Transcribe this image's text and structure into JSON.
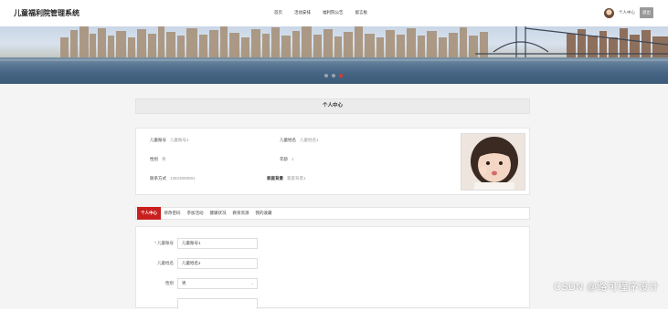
{
  "header": {
    "brand": "儿童福利院管理系统",
    "nav": [
      "首页",
      "活动安排",
      "福利院公告",
      "留言板"
    ],
    "user_center": "个人中心",
    "logout": "退出"
  },
  "carousel": {
    "slides": 3,
    "active_index": 2
  },
  "page_title": "个人中心",
  "profile": {
    "child_id_label": "儿童账号",
    "child_id_value": "儿童账号1",
    "child_name_label": "儿童姓名",
    "child_name_value": "儿童姓名1",
    "gender_label": "性别",
    "gender_value": "男",
    "age_label": "年龄",
    "age_value": "1",
    "phone_label": "联系方式",
    "phone_value": "13823888881",
    "family_label": "家庭背景",
    "family_value": "家庭背景1"
  },
  "tabs": [
    "个人中心",
    "修改密码",
    "参加活动",
    "健康状况",
    "教育资源",
    "我的收藏"
  ],
  "form": {
    "child_id_label": "儿童账号",
    "child_id_value": "儿童账号1",
    "child_name_label": "儿童姓名",
    "child_name_value": "儿童姓名1",
    "gender_label": "性别",
    "gender_value": "男"
  },
  "watermark": "CSDN @路可程序设计"
}
